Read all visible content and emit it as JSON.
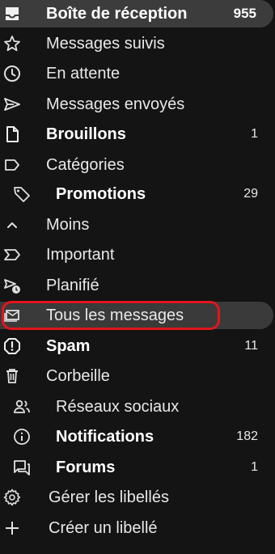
{
  "colors": {
    "background": "#141414",
    "selected_row": "#3c3c3c",
    "highlight_outline": "#e0161d",
    "text": "#e8e8e8"
  },
  "nav": {
    "inbox": {
      "label": "Boîte de réception",
      "count": "955",
      "icon": "inbox-icon"
    },
    "starred": {
      "label": "Messages suivis",
      "icon": "star-icon"
    },
    "snoozed": {
      "label": "En attente",
      "icon": "clock-icon"
    },
    "sent": {
      "label": "Messages envoyés",
      "icon": "send-icon"
    },
    "drafts": {
      "label": "Brouillons",
      "count": "1",
      "icon": "file-icon"
    },
    "categories": {
      "label": "Catégories",
      "icon": "label-icon"
    },
    "promotions": {
      "label": "Promotions",
      "count": "29",
      "icon": "tag-icon"
    },
    "less": {
      "label": "Moins",
      "icon": "chevron-up-icon"
    },
    "important": {
      "label": "Important",
      "icon": "important-icon"
    },
    "scheduled": {
      "label": "Planifié",
      "icon": "scheduled-send-icon"
    },
    "all_mail": {
      "label": "Tous les messages",
      "icon": "all-mail-icon"
    },
    "spam": {
      "label": "Spam",
      "count": "11",
      "icon": "report-icon"
    },
    "trash": {
      "label": "Corbeille",
      "icon": "trash-icon"
    },
    "social": {
      "label": "Réseaux sociaux",
      "icon": "people-icon"
    },
    "updates": {
      "label": "Notifications",
      "count": "182",
      "icon": "info-icon"
    },
    "forums": {
      "label": "Forums",
      "count": "1",
      "icon": "forum-icon"
    },
    "manage_labels": {
      "label": "Gérer les libellés",
      "icon": "gear-icon"
    },
    "create_label": {
      "label": "Créer un libellé",
      "icon": "plus-icon"
    }
  }
}
